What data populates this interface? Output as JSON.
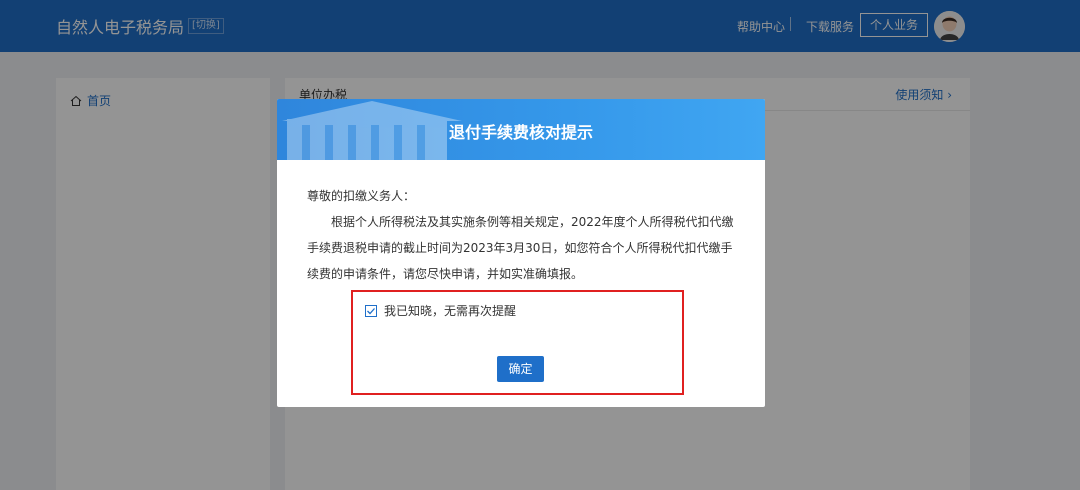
{
  "header": {
    "brand": "自然人电子税务局",
    "brand_tag": "[切换]",
    "help": "帮助中心",
    "download": "下载服务",
    "personal": "个人业务"
  },
  "sidebar": {
    "home": "首页"
  },
  "content": {
    "title": "单位办税",
    "help_link": "使用须知"
  },
  "modal": {
    "title": "退付手续费核对提示",
    "greeting": "尊敬的扣缴义务人：",
    "message": "根据个人所得税法及其实施条例等相关规定，2022年度个人所得税代扣代缴手续费退税申请的截止时间为2023年3月30日，如您符合个人所得税代扣代缴手续费的申请条件，请您尽快申请，并如实准确填报。",
    "checkbox_label": "我已知晓，无需再次提醒",
    "checkbox_checked": true,
    "confirm": "确定"
  },
  "colors": {
    "brand_blue": "#1f6fc9",
    "highlight_red": "#e02020"
  }
}
